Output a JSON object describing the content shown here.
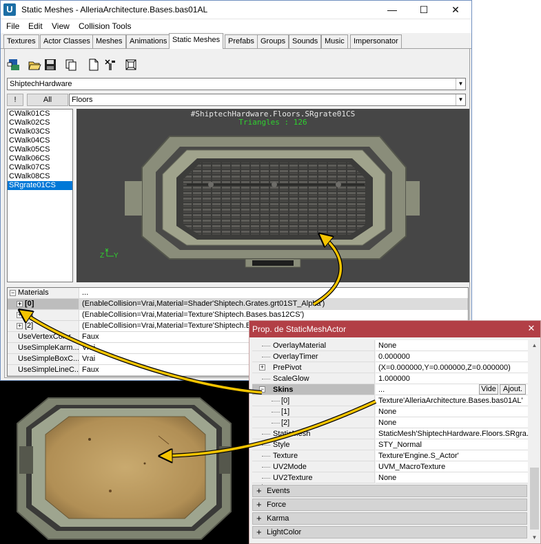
{
  "main_window": {
    "title": "Static Meshes - AlleriaArchitecture.Bases.bas01AL",
    "controls": {
      "minimize": "—",
      "maximize": "☐",
      "close": "✕"
    }
  },
  "menu": [
    "File",
    "Edit",
    "View",
    "Collision Tools"
  ],
  "tabs": [
    "Textures",
    "Actor Classes",
    "Meshes",
    "Animations",
    "Static Meshes",
    "Prefabs",
    "Groups",
    "Sounds",
    "Music",
    "Impersonator"
  ],
  "active_tab": "Static Meshes",
  "toolbar_icons": [
    "browser-icon",
    "open-folder-icon",
    "save-icon",
    "copy-icon",
    "new-document-icon",
    "tools-icon",
    "convert-icon"
  ],
  "package_combo": "ShiptechHardware",
  "filter_button": "!",
  "all_button": "All",
  "group_combo": "Floors",
  "mesh_list": [
    "CWalk01CS",
    "CWalk02CS",
    "CWalk03CS",
    "CWalk04CS",
    "CWalk05CS",
    "CWalk06CS",
    "CWalk07CS",
    "CWalk08CS",
    "SRgrate01CS"
  ],
  "selected_mesh": "SRgrate01CS",
  "viewport": {
    "mesh_name": "#ShiptechHardware.Floors.SRgrate01CS",
    "triangles": "Triangles : 126",
    "axis_z": "Z",
    "axis_y": "Y"
  },
  "property_grid": {
    "materials_label": "Materials",
    "materials_value": "...",
    "rows": [
      {
        "key": "[0]",
        "value": "(EnableCollision=Vrai,Material=Shader'Shiptech.Grates.grt01ST_Alpha')"
      },
      {
        "key": "[1]",
        "value": "(EnableCollision=Vrai,Material=Texture'Shiptech.Bases.bas12CS')"
      },
      {
        "key": "[2]",
        "value": "(EnableCollision=Vrai,Material=Texture'Shiptech.Bases"
      },
      {
        "key": "UseVertexColor",
        "value": "Faux"
      },
      {
        "key": "UseSimpleKarm...",
        "value": "Vrai"
      },
      {
        "key": "UseSimpleBoxC...",
        "value": "Vrai"
      },
      {
        "key": "UseSimpleLineC...",
        "value": "Faux"
      }
    ]
  },
  "props_window": {
    "title": "Prop. de StaticMeshActor",
    "close": "✕",
    "rows": [
      {
        "key": "OverlayMaterial",
        "value": "None"
      },
      {
        "key": "OverlayTimer",
        "value": "0.000000"
      },
      {
        "key": "PrePivot",
        "value": "(X=0.000000,Y=0.000000,Z=0.000000)"
      },
      {
        "key": "ScaleGlow",
        "value": "1.000000"
      },
      {
        "key": "Skins",
        "value": "..."
      },
      {
        "key": "[0]",
        "value": "Texture'AlleriaArchitecture.Bases.bas01AL'"
      },
      {
        "key": "[1]",
        "value": "None"
      },
      {
        "key": "[2]",
        "value": "None"
      },
      {
        "key": "StaticMesh",
        "value": "StaticMesh'ShiptechHardware.Floors.SRgra..."
      },
      {
        "key": "Style",
        "value": "STY_Normal"
      },
      {
        "key": "Texture",
        "value": "Texture'Engine.S_Actor'"
      },
      {
        "key": "UV2Mode",
        "value": "UVM_MacroTexture"
      },
      {
        "key": "UV2Texture",
        "value": "None"
      }
    ],
    "skins_buttons": [
      "Vide",
      "Ajout."
    ],
    "categories": [
      "Events",
      "Force",
      "Karma",
      "LightColor"
    ]
  },
  "colors": {
    "accent_arrow": "#f5c400",
    "props_title": "#b23f46",
    "selection": "#0078d7",
    "triangles_text": "#2ed12e"
  }
}
